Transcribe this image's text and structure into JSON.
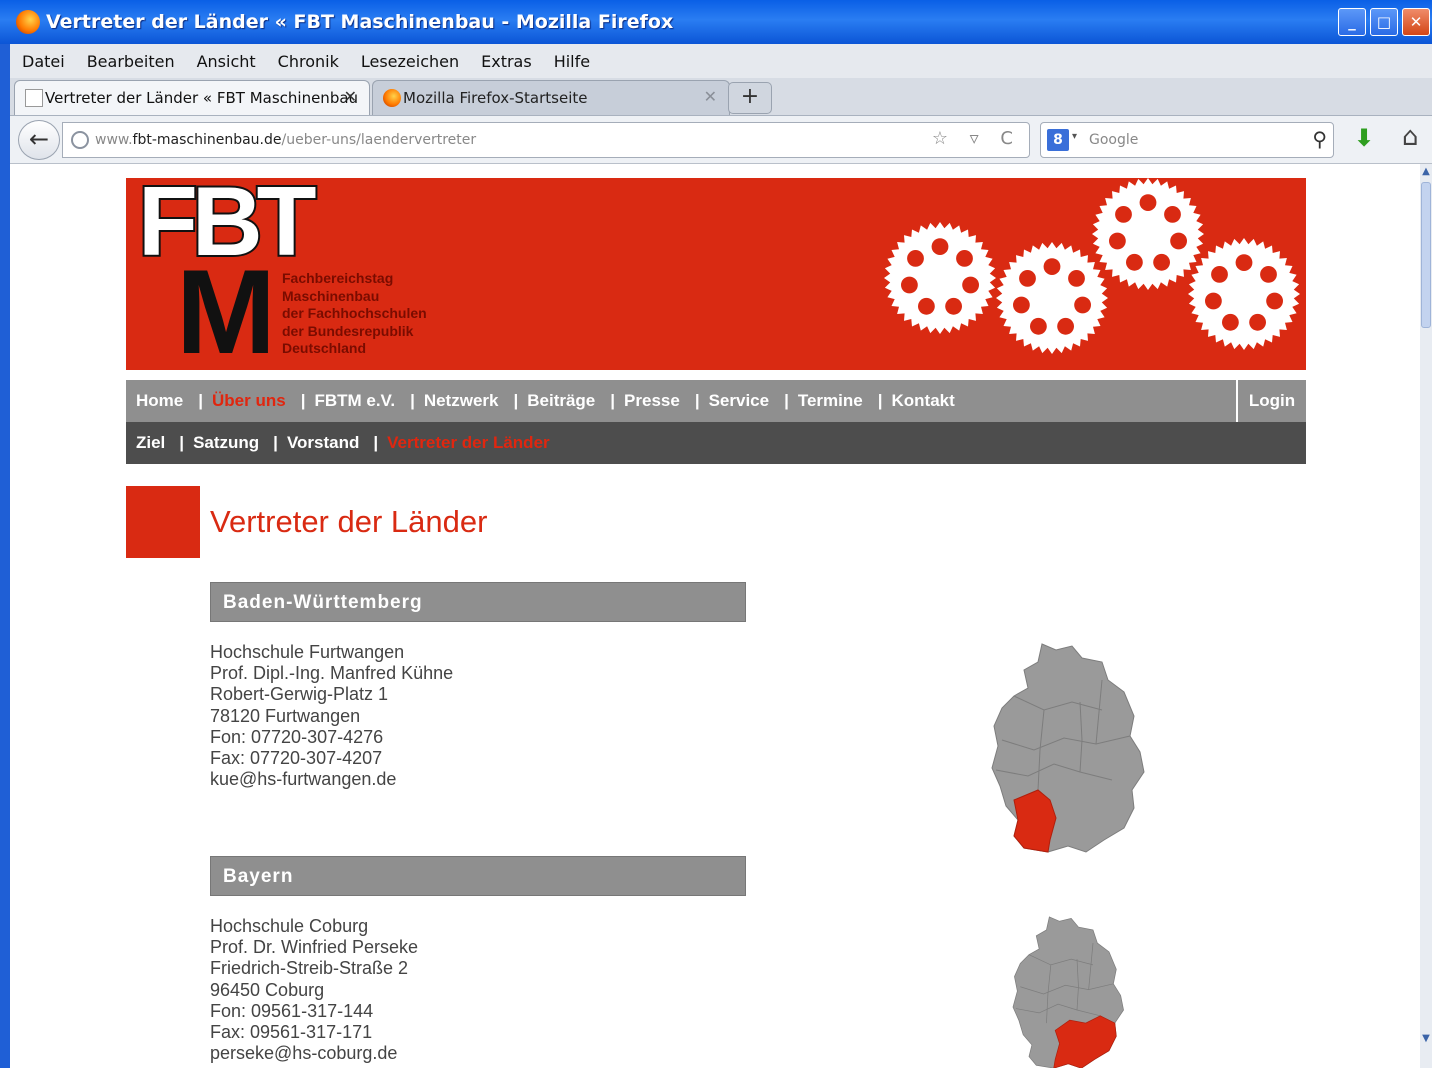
{
  "window": {
    "title": "Vertreter der Länder « FBT Maschinenbau - Mozilla Firefox",
    "min": "_",
    "max": "□",
    "close": "✕"
  },
  "menu": [
    "Datei",
    "Bearbeiten",
    "Ansicht",
    "Chronik",
    "Lesezeichen",
    "Extras",
    "Hilfe"
  ],
  "tabs": [
    {
      "label": "Vertreter der Länder « FBT Maschinenbau",
      "close": "✕"
    },
    {
      "label": "Mozilla Firefox-Startseite",
      "close": "✕"
    }
  ],
  "new_tab": "+",
  "nav": {
    "back": "←",
    "url_pre": "www.",
    "url_host": "fbt-maschinenbau.de",
    "url_path": "/ueber-uns/laendervertreter",
    "url_tools": "☆ ▿ C",
    "search_engine": "8",
    "search_drop": "▾",
    "search_placeholder": "Google",
    "search_icon": "⚲",
    "download": "⬇",
    "home": "⌂"
  },
  "scroll": {
    "up": "▲",
    "down": "▼"
  },
  "logo": {
    "fbt": "FBT",
    "m": "M",
    "lines": [
      "Fachbereichstag",
      "Maschinenbau",
      "der Fachhochschulen",
      "der Bundesrepublik",
      "Deutschland"
    ]
  },
  "main_nav": {
    "items": [
      "Home",
      "Über uns",
      "FBTM e.V.",
      "Netzwerk",
      "Beiträge",
      "Presse",
      "Service",
      "Termine",
      "Kontakt"
    ],
    "current": 1,
    "separator": "|",
    "login": "Login"
  },
  "sub_nav": {
    "items": [
      "Ziel",
      "Satzung",
      "Vorstand",
      "Vertreter der Länder"
    ],
    "current": 3,
    "separator": "|"
  },
  "page_title": "Vertreter der Länder",
  "states": [
    {
      "name": "Baden-Württemberg",
      "lines": [
        "Hochschule Furtwangen",
        "Prof. Dipl.-Ing. Manfred Kühne",
        "Robert-Gerwig-Platz 1",
        "78120 Furtwangen",
        "Fon: 07720-307-4276",
        "Fax: 07720-307-4207",
        "kue@hs-furtwangen.de"
      ],
      "highlight": "bw"
    },
    {
      "name": "Bayern",
      "lines": [
        "Hochschule Coburg",
        "Prof. Dr. Winfried Perseke",
        "Friedrich-Streib-Straße 2",
        "96450 Coburg",
        "Fon: 09561-317-144",
        "Fax: 09561-317-171",
        "perseke@hs-coburg.de"
      ],
      "highlight": "by"
    }
  ],
  "colors": {
    "brand_red": "#d92a12",
    "nav_gray": "#8f8f8f",
    "subnav_dark": "#4d4d4d",
    "map_gray": "#9a9a9a"
  }
}
